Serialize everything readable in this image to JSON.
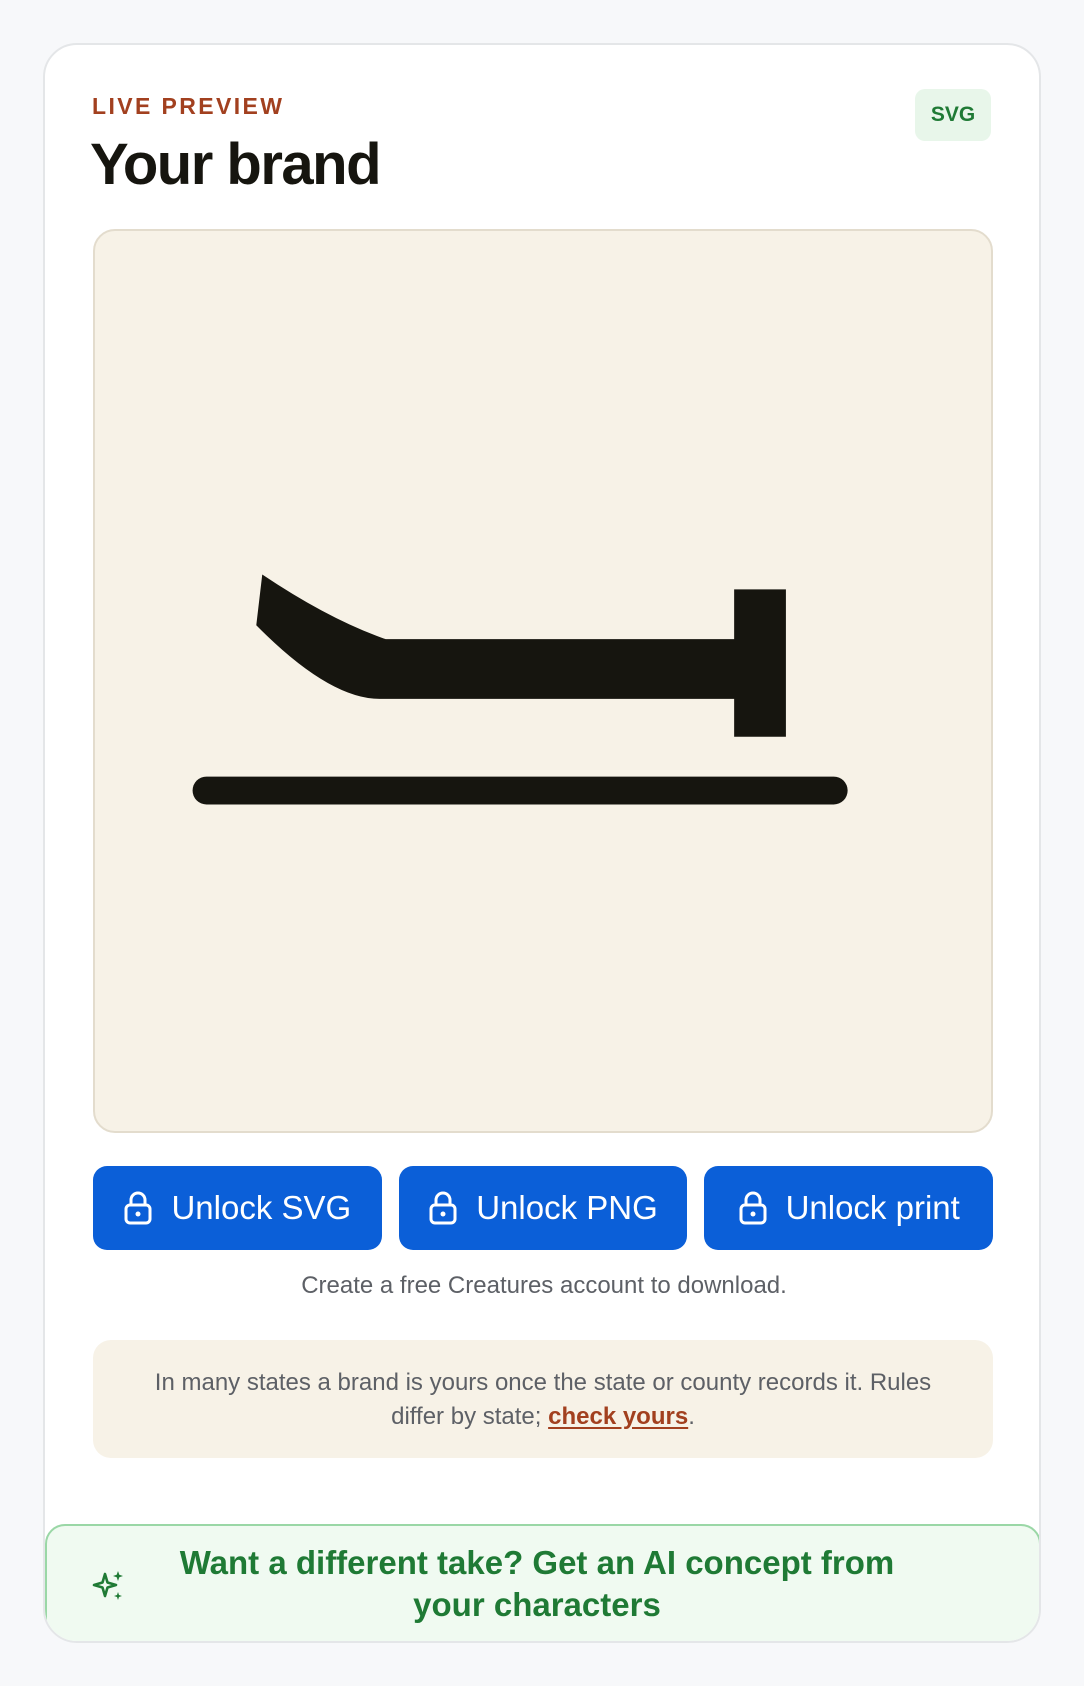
{
  "header": {
    "eyebrow": "LIVE PREVIEW",
    "title": "Your brand",
    "format_badge": "SVG"
  },
  "preview": {
    "background": "#f7f2e7",
    "ink": "#16150f"
  },
  "actions": {
    "unlock_svg": "Unlock SVG",
    "unlock_png": "Unlock PNG",
    "unlock_print": "Unlock print",
    "icon": "lock-icon",
    "color": "#0b5fd8"
  },
  "note": "Create a free Creatures account to download.",
  "info": {
    "text_before": "In many states a brand is yours once the state or county records it. Rules differ by state; ",
    "link_label": "check yours",
    "text_after": "."
  },
  "cta": {
    "icon": "sparkle-icon",
    "label": "Want a different take? Get an AI concept from your characters",
    "color": "#1f7a35"
  }
}
